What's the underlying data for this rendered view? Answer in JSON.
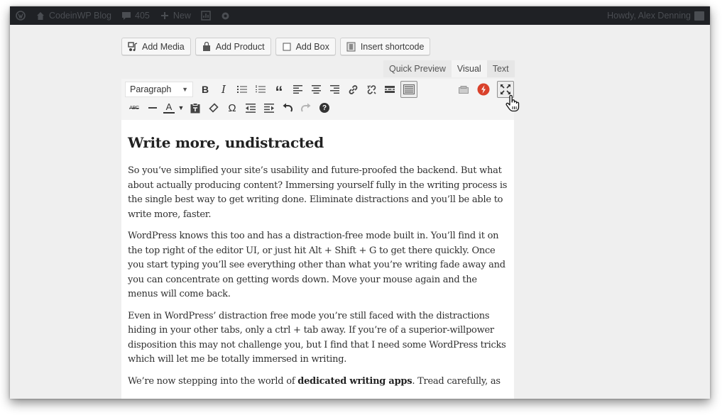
{
  "adminbar": {
    "wp_logo_icon": "wordpress-logo",
    "site_icon": "home-icon",
    "site_name": "CodeinWP Blog",
    "comments_icon": "speech-bubble",
    "comments_count": "405",
    "new_icon": "plus",
    "new_label": "New",
    "extra_icons": [
      "shield-chart",
      "gear"
    ],
    "greeting": "Howdy, Alex Denning",
    "avatar_icon": "user-avatar"
  },
  "media_buttons": [
    {
      "label": "Add Media",
      "icon": "media-music"
    },
    {
      "label": "Add Product",
      "icon": "shopping-bag"
    },
    {
      "label": "Add Box",
      "icon": "square-outline"
    },
    {
      "label": "Insert shortcode",
      "icon": "shortcode"
    }
  ],
  "editor_tabs": {
    "quick_preview": "Quick Preview",
    "visual": "Visual",
    "text": "Text",
    "active": "Visual"
  },
  "toolbar": {
    "format_select": "Paragraph",
    "row1": [
      "bold",
      "italic",
      "bulleted-list",
      "numbered-list",
      "blockquote",
      "align-left",
      "align-center",
      "align-right",
      "insert-link",
      "remove-link",
      "read-more",
      "toolbar-toggle"
    ],
    "row2": [
      "strikethrough",
      "horizontal-line",
      "text-color",
      "paste-as-text",
      "clear-formatting",
      "special-character",
      "decrease-indent",
      "increase-indent",
      "undo",
      "redo",
      "keyboard-shortcuts"
    ],
    "right": [
      "shortcode-box",
      "lightning-plugin",
      "distraction-free-mode"
    ],
    "bold_glyph": "B",
    "italic_glyph": "I",
    "quote_glyph": "“",
    "omega_glyph": "Ω",
    "color_glyph": "A",
    "strike_glyph": "ABC",
    "help_glyph": "?"
  },
  "content": {
    "heading": "Write more, undistracted",
    "paragraphs": [
      "So you’ve simplified your site’s usability and future-proofed the backend. But what about actually producing content? Immersing yourself fully in the writing process is the single best way to get writing done. Eliminate distractions and you’ll be able to write more, faster.",
      "WordPress knows this too and has a distraction-free mode built in. You’ll find it on the top right of the editor UI, or just hit Alt + Shift + G to get there quickly. Once you start typing you’ll see everything other than what you’re writing fade away and you can concentrate on getting words down. Move your mouse again and the menus will come back.",
      "Even in WordPress’ distraction free mode you’re still faced with the distractions hiding in your other tabs, only a ctrl + tab away. If you’re of a superior-willpower disposition this may not challenge you, but I find that I need some WordPress tricks which will let me be totally immersed in writing."
    ],
    "last_paragraph": {
      "before": "We’re now stepping into the world of ",
      "bold": "dedicated writing apps",
      "after": ". Tread carefully, as"
    }
  },
  "colors": {
    "adminbar_bg": "#1f2125",
    "lightning_red": "#d9412b",
    "page_bg": "#efefef"
  }
}
